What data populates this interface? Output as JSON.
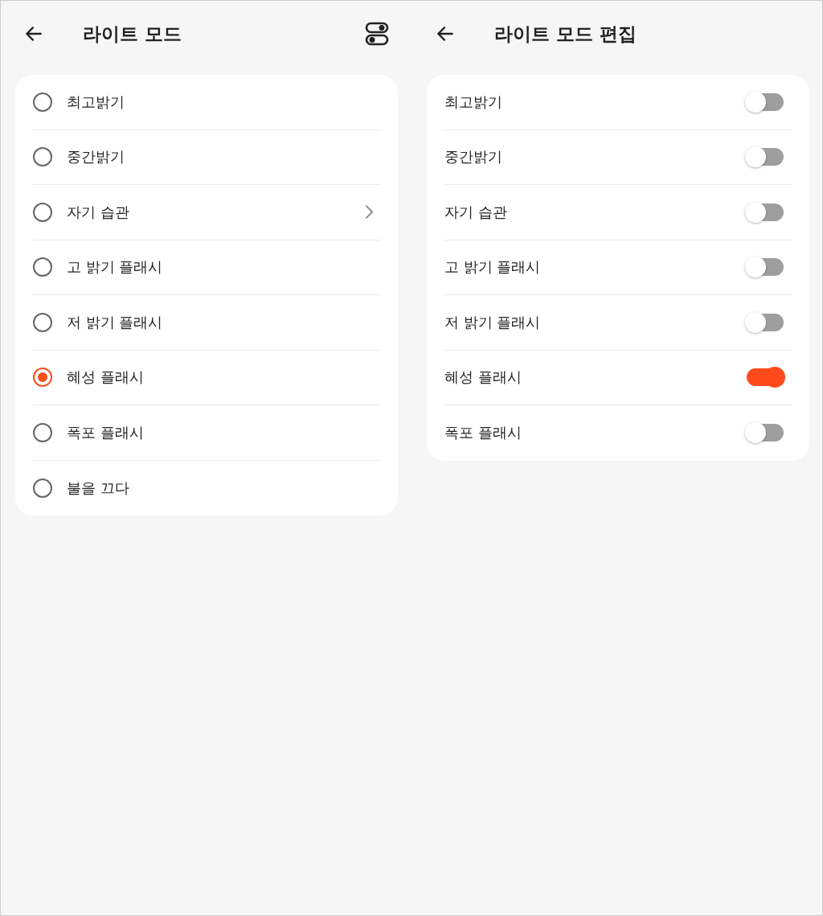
{
  "left": {
    "title": "라이트 모드",
    "options": [
      {
        "label": "최고밝기",
        "selected": false,
        "chevron": false
      },
      {
        "label": "중간밝기",
        "selected": false,
        "chevron": false
      },
      {
        "label": "자기 습관",
        "selected": false,
        "chevron": true
      },
      {
        "label": "고 밝기 플래시",
        "selected": false,
        "chevron": false
      },
      {
        "label": "저 밝기 플래시",
        "selected": false,
        "chevron": false
      },
      {
        "label": "혜성 플래시",
        "selected": true,
        "chevron": false
      },
      {
        "label": "폭포 플래시",
        "selected": false,
        "chevron": false
      },
      {
        "label": "불을 끄다",
        "selected": false,
        "chevron": false
      }
    ]
  },
  "right": {
    "title": "라이트 모드 편집",
    "modes": [
      {
        "label": "최고밝기",
        "on": false
      },
      {
        "label": "중간밝기",
        "on": false
      },
      {
        "label": "자기 습관",
        "on": false
      },
      {
        "label": "고 밝기 플래시",
        "on": false
      },
      {
        "label": "저 밝기 플래시",
        "on": false
      },
      {
        "label": "혜성 플래시",
        "on": true
      },
      {
        "label": "폭포 플래시",
        "on": false
      }
    ]
  }
}
